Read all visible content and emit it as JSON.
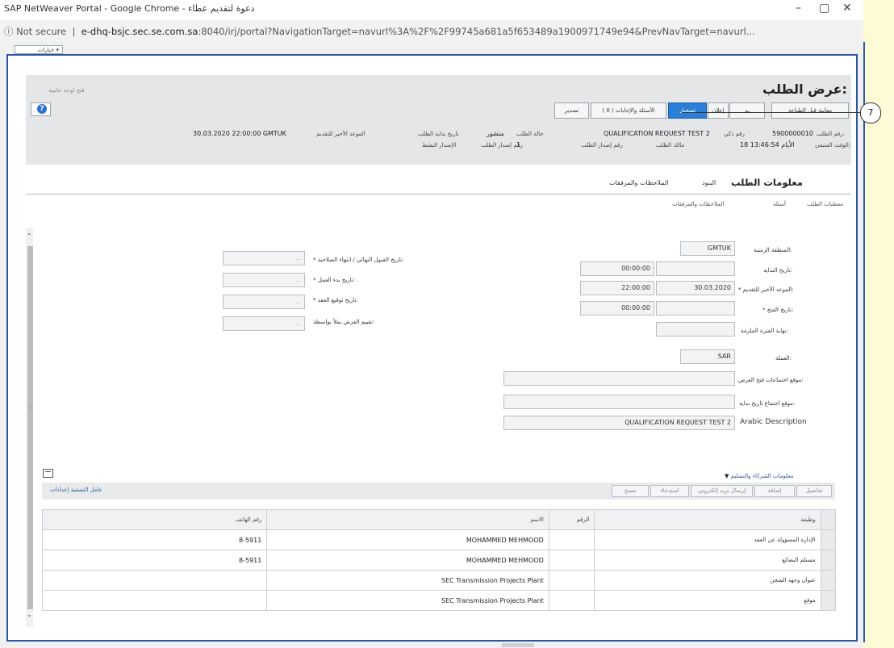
{
  "window": {
    "title": "SAP NetWeaver Portal - Google Chrome - دعوة لتقديم عطاء",
    "controls": {
      "minimize": "–",
      "maximize": "▢",
      "close": "✕"
    }
  },
  "address_bar": {
    "security": "Not secure",
    "domain": "e-dhq-bsjc.sec.se.com.sa",
    "rest": ":8040/irj/portal?NavigationTarget=navurl%3A%2F%2F99745a681a5f653489a1900971749e94&PrevNavTarget=navurl..."
  },
  "portal": {
    "options_label": "خيارات ▾"
  },
  "header": {
    "title": "عرض الطلب:",
    "side_link": "فتح لوحة جانبية",
    "help_label": "?",
    "toolbar": [
      {
        "label": "معاينة قبل الطباعة",
        "primary": false
      },
      {
        "label": "ـه",
        "primary": false
      },
      {
        "label": "إعلان",
        "primary": false
      },
      {
        "label": "تسجيل",
        "primary": true
      },
      {
        "label": "الأسئلة والإجابات ( 0 )",
        "primary": false
      },
      {
        "label": "تصدير",
        "primary": false
      }
    ],
    "meta": {
      "number_label": "رقم الطلب:",
      "number_value": "5900000010",
      "remaining_label": "الوقت المتبقي:",
      "remaining_value": "18 الأيام 13:46:54",
      "name_label": "رقم ذكي",
      "name_value": "QUALIFICATION REQUEST TEST 2",
      "owner_label": "مالك الطلب",
      "version_label": "رقم إصدار الطلب",
      "status_label": "حالة الطلب",
      "status_value": "منشور",
      "version_num_label": "رقم إصدار الطلب",
      "version_num_value": "1",
      "start_label": "تاريخ بداية الطلب",
      "active_label": "الإصدار النشط",
      "deadline_label": "الموعد الأخير للتقديم",
      "deadline_value": "30.03.2020 22:00:00 GMTUK"
    },
    "callout": "7"
  },
  "tabs": {
    "selected": "معلومات الطلب",
    "items": [
      "البنود",
      "الملاحظات والمرفقات"
    ],
    "subtabs": [
      "معطيات الطلب",
      "أسئلة",
      "الملاحظات والمرفقات"
    ]
  },
  "form_right": {
    "timezone_label": "المنطقة الزمنية:",
    "timezone_value": "GMTUK",
    "start_label": "تاريخ البداية:",
    "start_time": "00:00:00",
    "deadline_label": "* الموعد الأخير للتقديم:",
    "deadline_date": "30.03.2020",
    "deadline_time": "22:00:00",
    "opening_label": "* تاريخ الفتح:",
    "opening_time": "00:00:00",
    "binding_label": "نهاية الفترة الملزمة:",
    "currency_label": "العملة:",
    "currency_value": "SAR",
    "loc_open_label": "موقع اجتماعات فتح العرض:",
    "loc_start_label": "موقع اجتماع تاريخ بداية:",
    "arabic_label": "Arabic Description",
    "arabic_value": "QUALIFICATION REQUEST TEST 2"
  },
  "form_left": {
    "final_accept_label": "* تاريخ القبول النهائي / انتهاء الصلاحية:",
    "work_start_label": "* تاريخ بدء العمل:",
    "contract_sign_label": "* تاريخ توقيع العقد:",
    "evaluated_by_label": "تقييم العرض يملأ بواسطة:",
    "placeholder": ". ."
  },
  "partners": {
    "section_title": "معلومات الشركاء والتسليم",
    "buttons": [
      "تفاصيل",
      "إضافة",
      "إرسال بريد إلكتروني",
      "استدعاء",
      "مسح"
    ],
    "settings_link": "عامل التصفية إعدادات",
    "columns": {
      "function": "وظيفة",
      "number": "الرقم",
      "name": "الاسم",
      "phone": "رقم الهاتف"
    },
    "rows": [
      {
        "function": "الإدارة المسؤولة عن العقد",
        "number": "",
        "name": "MOHAMMED MEHMOOD",
        "phone": "8-5911"
      },
      {
        "function": "مستلم البضائع",
        "number": "",
        "name": "MOHAMMED MEHMOOD",
        "phone": "8-5911"
      },
      {
        "function": "عنوان وجهة الشحن",
        "number": "",
        "name": "SEC Transmission Projects Plant",
        "phone": ""
      },
      {
        "function": "موقع",
        "number": "",
        "name": "SEC Transmission Projects Plant",
        "phone": ""
      }
    ]
  }
}
